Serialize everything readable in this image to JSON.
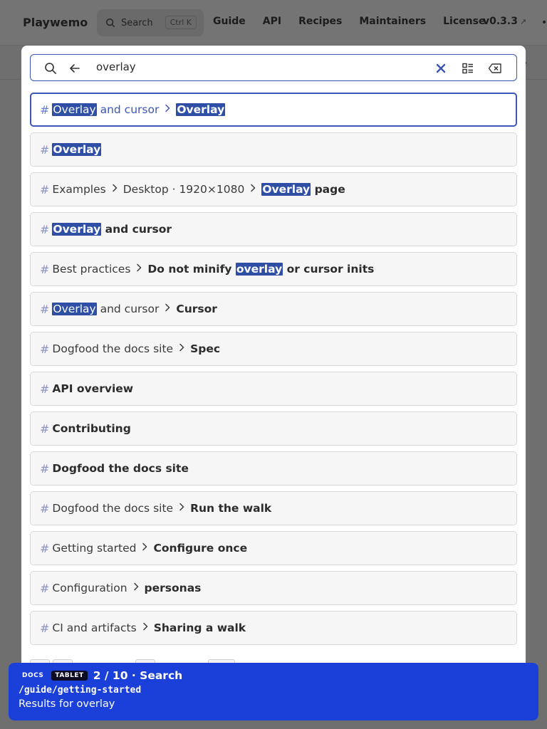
{
  "background": {
    "logo": "Playwemo",
    "search": {
      "label": "Search",
      "shortcut": "Ctrl K"
    },
    "nav_links": [
      "Guide",
      "API",
      "Recipes",
      "Maintainers",
      "License"
    ],
    "version": "v0.3.3",
    "version_ext": "↗",
    "more": "•"
  },
  "search": {
    "query": "overlay"
  },
  "results": [
    {
      "crumbs": [],
      "title": [
        {
          "t": "Overlay",
          "h": true
        },
        {
          "t": " and cursor",
          "h": false
        }
      ],
      "tail": [
        {
          "t": "Overlay",
          "h": true
        }
      ],
      "active": true,
      "title_as_crumb": true
    },
    {
      "crumbs": [],
      "title": [
        {
          "t": "Overlay",
          "h": true
        }
      ]
    },
    {
      "crumbs": [
        "Examples",
        "Desktop · 1920×1080"
      ],
      "title": [
        {
          "t": "Overlay",
          "h": true
        },
        {
          "t": " page",
          "h": false
        }
      ]
    },
    {
      "crumbs": [],
      "title": [
        {
          "t": "Overlay",
          "h": true
        },
        {
          "t": " and cursor",
          "h": false
        }
      ]
    },
    {
      "crumbs": [
        "Best practices"
      ],
      "title": [
        {
          "t": "Do not minify ",
          "h": false
        },
        {
          "t": "overlay",
          "h": true
        },
        {
          "t": " or cursor inits",
          "h": false
        }
      ]
    },
    {
      "crumbs_rich": [
        {
          "t": "Overlay",
          "h": true
        },
        {
          "t": " and cursor",
          "h": false
        }
      ],
      "title": [
        {
          "t": "Cursor",
          "h": false
        }
      ]
    },
    {
      "crumbs": [
        "Dogfood the docs site"
      ],
      "title": [
        {
          "t": "Spec",
          "h": false
        }
      ]
    },
    {
      "crumbs": [],
      "title": [
        {
          "t": "API overview",
          "h": false
        }
      ]
    },
    {
      "crumbs": [],
      "title": [
        {
          "t": "Contributing",
          "h": false
        }
      ]
    },
    {
      "crumbs": [],
      "title": [
        {
          "t": "Dogfood the docs site",
          "h": false
        }
      ]
    },
    {
      "crumbs": [
        "Dogfood the docs site"
      ],
      "title": [
        {
          "t": "Run the walk",
          "h": false
        }
      ]
    },
    {
      "crumbs": [
        "Getting started"
      ],
      "title": [
        {
          "t": "Configure once",
          "h": false
        }
      ]
    },
    {
      "crumbs": [
        "Configuration"
      ],
      "title": [
        {
          "t": "personas",
          "h": false
        }
      ]
    },
    {
      "crumbs": [
        "CI and artifacts"
      ],
      "title": [
        {
          "t": "Sharing a walk",
          "h": false
        }
      ]
    }
  ],
  "toast": {
    "tag_docs": "DOCS",
    "tag_device": "TABLET",
    "title": "2 / 10 · Search",
    "path": "/guide/getting-started",
    "message": "Results for overlay"
  },
  "colors": {
    "accent": "#3c56b8",
    "highlight": "#2f4ea6",
    "toast": "#1a40d9",
    "overlay": "#6f6f6f"
  }
}
